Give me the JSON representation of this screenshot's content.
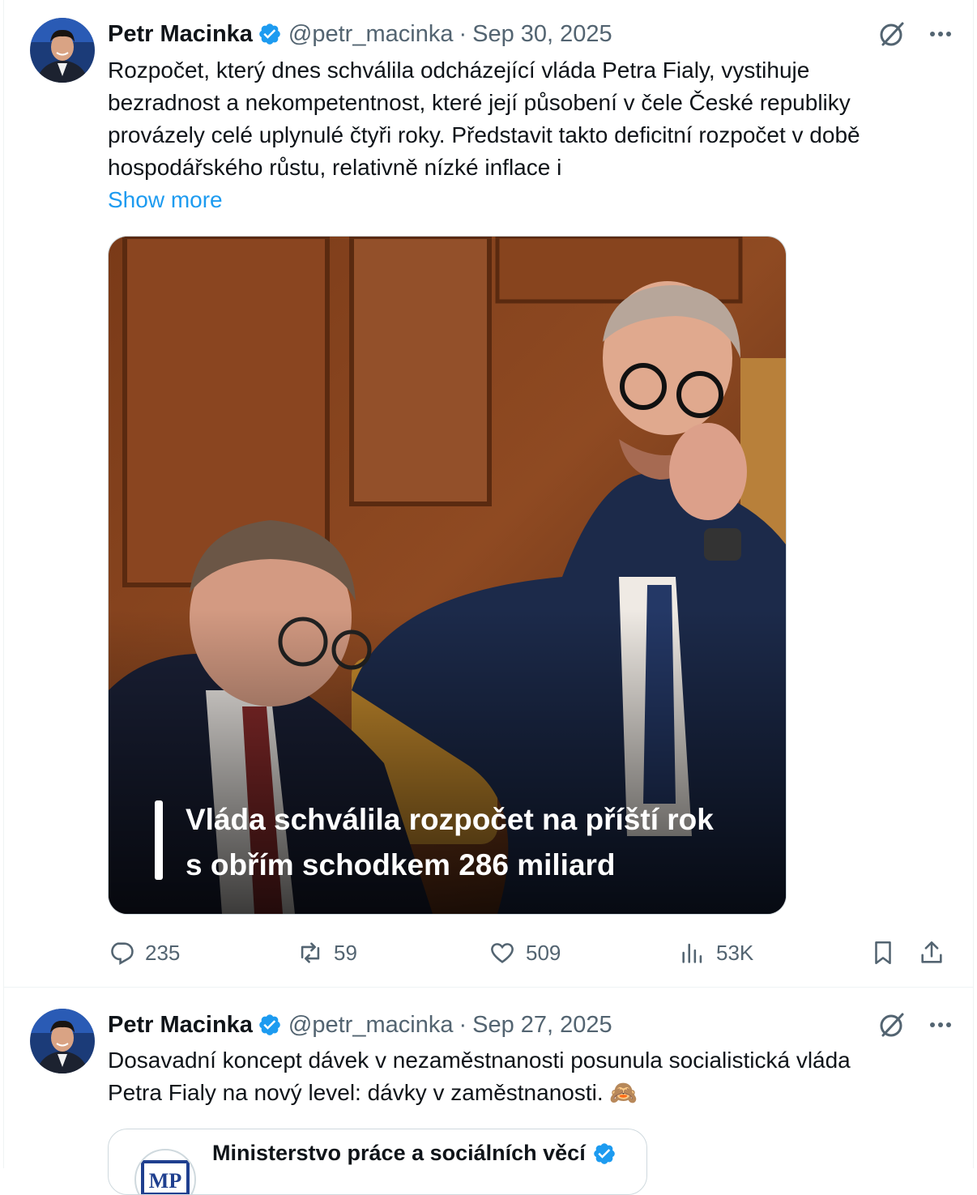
{
  "tweets": [
    {
      "author": "Petr Macinka",
      "handle": "@petr_macinka",
      "separator": "·",
      "date": "Sep 30, 2025",
      "text_lines": [
        "Rozpočet, který dnes schválila odcházející vláda Petra Fialy, vystihuje",
        "bezradnost a nekompetentnost, které její působení v čele České republiky",
        "provázely celé uplynulé čtyři roky. Představit takto deficitní rozpočet v době",
        "hospodářského růstu, relativně nízké inflace i"
      ],
      "show_more": "Show more",
      "media_caption_lines": [
        "Vláda schválila rozpočet na příští rok",
        "s obřím schodkem 286 miliard"
      ],
      "stats": {
        "replies": "235",
        "reposts": "59",
        "likes": "509",
        "views": "53K"
      }
    },
    {
      "author": "Petr Macinka",
      "handle": "@petr_macinka",
      "separator": "·",
      "date": "Sep 27, 2025",
      "text_lines": [
        "Dosavadní koncept dávek v nezaměstnanosti posunula socialistická vláda",
        "Petra Fialy na nový level: dávky v zaměstnanosti. 🙈"
      ],
      "quote": {
        "author": "Ministerstvo práce a sociálních věcí",
        "logo_text": "MP"
      }
    }
  ],
  "colors": {
    "verified": "#1d9bf0",
    "link": "#1d9bf0",
    "secondary_text": "#536471",
    "divider": "#eff3f4"
  },
  "icons": [
    "verified-badge-icon",
    "grok-icon",
    "more-icon",
    "reply-icon",
    "repost-icon",
    "like-icon",
    "views-icon",
    "bookmark-icon",
    "share-icon"
  ]
}
